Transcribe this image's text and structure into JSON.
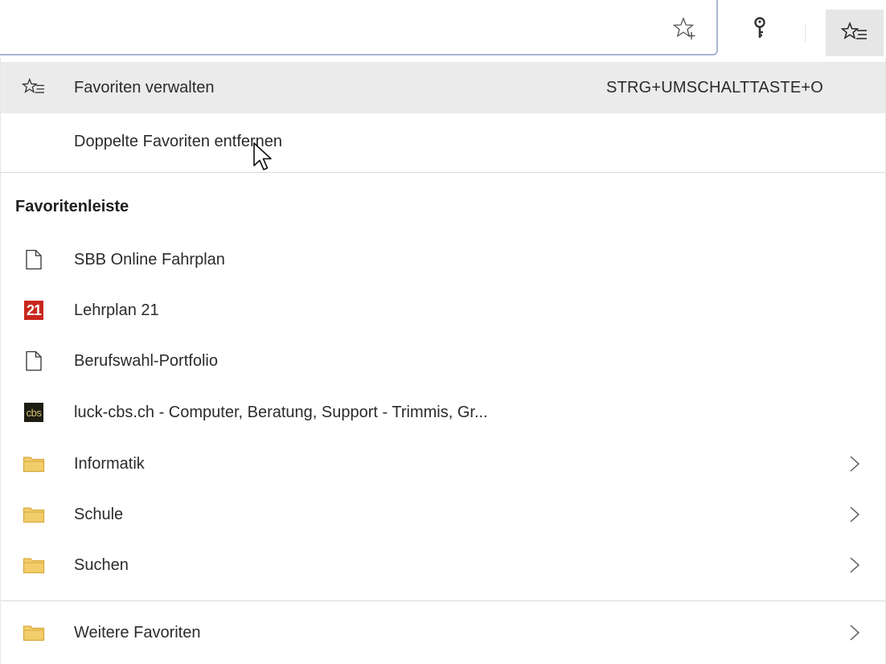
{
  "toolbar": {
    "add_favorite_icon": "star-plus-icon",
    "key_icon": "key-icon",
    "hub_icon": "favorites-hub-icon"
  },
  "menu": {
    "manage": {
      "label": "Favoriten verwalten",
      "shortcut": "STRG+UMSCHALTTASTE+O",
      "icon": "star-list-icon"
    },
    "remove_duplicates": {
      "label": "Doppelte Favoriten entfernen"
    },
    "section_title": "Favoritenleiste",
    "items": [
      {
        "label": "SBB Online Fahrplan",
        "icon": "page-icon",
        "has_children": false
      },
      {
        "label": "Lehrplan 21",
        "icon": "lehrplan21-favicon",
        "badge": "21",
        "has_children": false
      },
      {
        "label": "Berufswahl-Portfolio",
        "icon": "page-icon",
        "has_children": false
      },
      {
        "label": "luck-cbs.ch - Computer, Beratung, Support - Trimmis, Gr...",
        "icon": "cbs-favicon",
        "badge": "cbs",
        "has_children": false
      },
      {
        "label": "Informatik",
        "icon": "folder-icon",
        "has_children": true
      },
      {
        "label": "Schule",
        "icon": "folder-icon",
        "has_children": true
      },
      {
        "label": "Suchen",
        "icon": "folder-icon",
        "has_children": true
      }
    ],
    "other": {
      "label": "Weitere Favoriten",
      "icon": "folder-icon",
      "has_children": true
    }
  },
  "colors": {
    "folder": "#f2cd6b",
    "folder_stroke": "#d8a93a",
    "hover_row": "#ebebeb",
    "divider": "#d9d9d9",
    "badge_21": "#c8281e",
    "badge_cbs": "#1d1d12"
  }
}
